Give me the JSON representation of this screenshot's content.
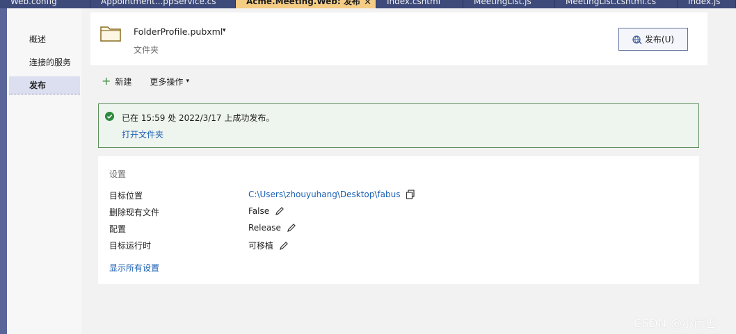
{
  "tabs": [
    {
      "label": "Web.config",
      "active": false
    },
    {
      "label": "Appointment...ppService.cs",
      "active": false
    },
    {
      "label": "Acme.Meeting.Web: 发布",
      "active": true
    },
    {
      "label": "Index.cshtml",
      "active": false
    },
    {
      "label": "MeetingList.js",
      "active": false
    },
    {
      "label": "MeetingList.cshtml.cs",
      "active": false
    },
    {
      "label": "Index.js",
      "active": false
    }
  ],
  "tab_controls": {
    "pin": "⊣",
    "close": "✕"
  },
  "sidebar": {
    "items": [
      {
        "label": "概述",
        "selected": false
      },
      {
        "label": "连接的服务",
        "selected": false
      },
      {
        "label": "发布",
        "selected": true
      }
    ]
  },
  "profile": {
    "name": "FolderProfile.pubxml",
    "caret": "▾",
    "type": "文件夹",
    "publish_button": "发布(U)"
  },
  "toolbar": {
    "new_label": "新建",
    "plus": "+",
    "more_label": "更多操作",
    "more_caret": "▾"
  },
  "status": {
    "message": "已在 15:59 处 2022/3/17 上成功发布。",
    "open_folder": "打开文件夹",
    "color": "#2d8a3e"
  },
  "settings": {
    "title": "设置",
    "rows": [
      {
        "key": "目标位置",
        "value": "C:\\Users\\zhouyuhang\\Desktop\\fabus",
        "link": true,
        "icon": "copy-icon"
      },
      {
        "key": "删除现有文件",
        "value": "False",
        "link": false,
        "icon": "edit-icon"
      },
      {
        "key": "配置",
        "value": "Release",
        "link": false,
        "icon": "edit-icon"
      },
      {
        "key": "目标运行时",
        "value": "可移植",
        "link": false,
        "icon": "edit-icon"
      }
    ],
    "show_all": "显示所有设置"
  },
  "watermark": "CSDN @小西巴",
  "colors": {
    "accent_tab": "#f5cc84",
    "tab_bar": "#3d4a7a",
    "link": "#1a5fb4",
    "success": "#2d8a3e"
  }
}
